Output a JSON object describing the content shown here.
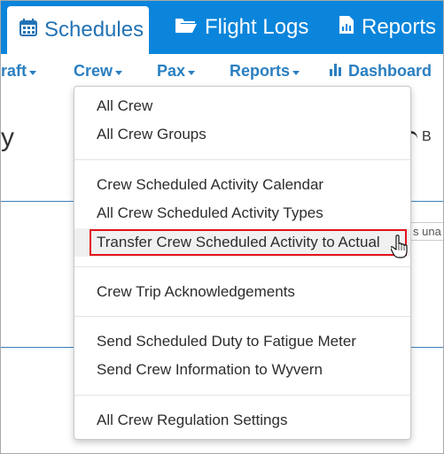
{
  "tabs": [
    {
      "label": "Schedules",
      "icon": "calendar-icon",
      "active": true
    },
    {
      "label": "Flight Logs",
      "icon": "folder-icon",
      "active": false
    },
    {
      "label": "Reports",
      "icon": "document-icon",
      "active": false
    }
  ],
  "subnav": {
    "aircraft": "raft",
    "crew": "Crew",
    "pax": "Pax",
    "reports": "Reports",
    "dashboard": "Dashboard"
  },
  "page": {
    "heading": "y",
    "back_label": "B",
    "side_text": "s una"
  },
  "menu": {
    "items": [
      "All Crew",
      "All Crew Groups",
      "Crew Scheduled Activity Calendar",
      "All Crew Scheduled Activity Types",
      "Transfer Crew Scheduled Activity to Actual",
      "Crew Trip Acknowledgements",
      "Send Scheduled Duty to Fatigue Meter",
      "Send Crew Information to Wyvern",
      "All Crew Regulation Settings"
    ],
    "highlighted_index": 4
  },
  "colors": {
    "primary": "#0b85db",
    "link": "#2a7fc1",
    "highlight_border": "#e1121c"
  }
}
